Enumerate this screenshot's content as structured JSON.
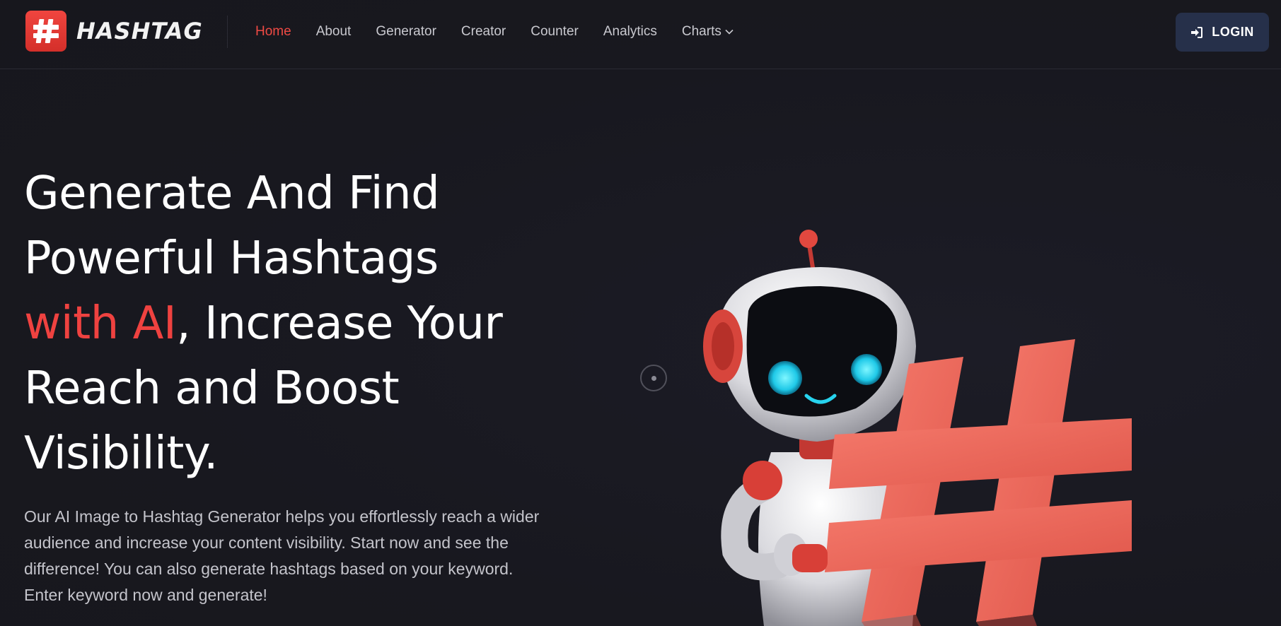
{
  "brand": {
    "name": "HASHTAG",
    "logo_icon": "hashtag-icon",
    "accent": "#ef4240"
  },
  "nav": {
    "items": [
      {
        "label": "Home",
        "active": true
      },
      {
        "label": "About",
        "active": false
      },
      {
        "label": "Generator",
        "active": false
      },
      {
        "label": "Creator",
        "active": false
      },
      {
        "label": "Counter",
        "active": false
      },
      {
        "label": "Analytics",
        "active": false
      },
      {
        "label": "Charts",
        "active": false,
        "dropdown": true
      }
    ],
    "login_label": "LOGIN",
    "login_icon": "sign-in-icon"
  },
  "hero": {
    "title_line1": "Generate And Find",
    "title_line2": "Powerful Hashtags",
    "title_accent": "with AI",
    "title_line3_rest": ", Increase Your",
    "title_line4": "Reach and Boost",
    "title_line5": "Visibility.",
    "description": "Our AI Image to Hashtag Generator helps you effortlessly reach a wider audience and increase your content visibility. Start now and see the difference! You can also generate hashtags based on your keyword. Enter keyword now and generate!",
    "illustration": "robot-holding-hashtag"
  },
  "colors": {
    "background": "#191922",
    "nav_text": "#c9c9cf",
    "login_bg": "#26304a"
  }
}
